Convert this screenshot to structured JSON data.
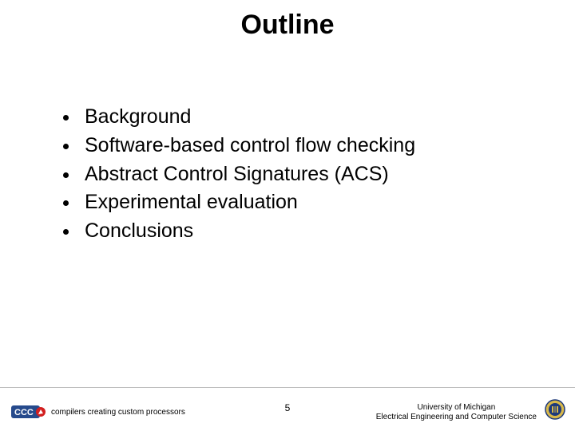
{
  "title": "Outline",
  "bullets": [
    "Background",
    "Software-based control flow checking",
    "Abstract Control Signatures (ACS)",
    "Experimental evaluation",
    "Conclusions"
  ],
  "page_number": "5",
  "footer": {
    "affiliation_line1": "University of Michigan",
    "affiliation_line2": "Electrical Engineering and Computer Science",
    "logo_tagline": "compilers creating custom processors",
    "logo_abbr": "CCC"
  },
  "icons": {
    "ccc_logo": "ccc-logo-icon",
    "seal": "university-seal-icon"
  },
  "colors": {
    "ccc_blue": "#264a8c",
    "ccc_red": "#d21f1f",
    "seal_blue": "#1e3a7b",
    "seal_gold": "#d8b84a"
  }
}
